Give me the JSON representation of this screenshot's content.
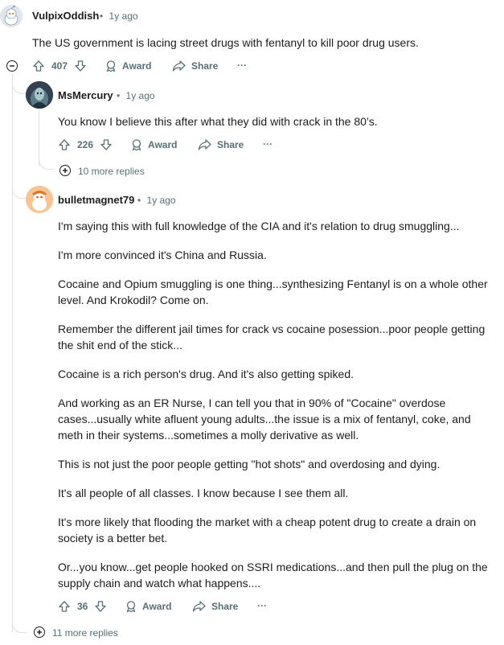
{
  "comments": [
    {
      "username": "VulpixOddish",
      "time": "1y ago",
      "body": [
        "The US government is lacing street drugs with fentanyl to kill poor drug users."
      ],
      "score": "407",
      "award_label": "Award",
      "share_label": "Share",
      "more_label": "···"
    },
    {
      "username": "MsMercury",
      "time": "1y ago",
      "body": [
        "You know I believe this after what they did with crack in the 80’s."
      ],
      "score": "226",
      "award_label": "Award",
      "share_label": "Share",
      "more_label": "···",
      "more_replies": "10 more replies"
    },
    {
      "username": "bulletmagnet79",
      "time": "1y ago",
      "body": [
        "I'm saying this with full knowledge of the CIA and it's relation to drug smuggling...",
        "I'm more convinced it's China and Russia.",
        "Cocaine and Opium smuggling is one thing...synthesizing Fentanyl is on a whole other level. And Krokodil? Come on.",
        "Remember the different jail times for crack vs cocaine posession...poor people getting the shit end of the stick...",
        "Cocaine is a rich person's drug. And it's also getting spiked.",
        "And working as an ER Nurse, I can tell you that in 90% of \"Cocaine\" overdose cases...usually white afluent young adults...the issue is a mix of fentanyl, coke, and meth in their systems...sometimes a molly derivative as well.",
        "This is not just the poor people getting \"hot shots\" and overdosing and dying.",
        "It's all people of all classes. I know because I see them all.",
        "It's more likely that flooding the market with a cheap potent drug to create a drain on society is a better bet.",
        "Or...you know...get people hooked on SSRI medications...and then pull the plug on the supply chain and watch what happens...."
      ],
      "score": "36",
      "award_label": "Award",
      "share_label": "Share",
      "more_label": "···"
    }
  ],
  "bottom_more_replies": "11 more replies",
  "separator": "•",
  "icons": {
    "upvote": "upvote-icon",
    "downvote": "downvote-icon",
    "award": "award-icon",
    "share": "share-icon",
    "collapse": "collapse-icon",
    "expand": "expand-icon"
  },
  "colors": {
    "text": "#1c1c1c",
    "meta": "#576f76",
    "thread_line": "#e0e0e0"
  }
}
